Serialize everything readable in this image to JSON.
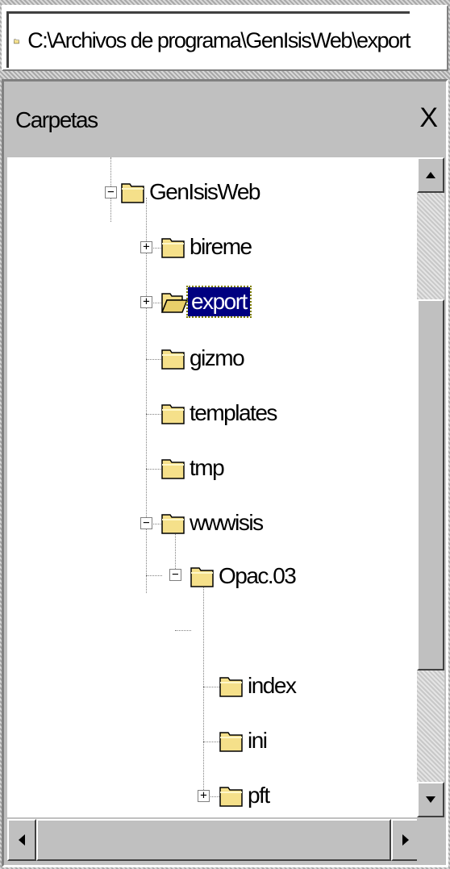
{
  "address": {
    "path": "C:\\Archivos de programa\\GenIsisWeb\\export",
    "icon": "folder-icon"
  },
  "panel": {
    "title": "Carpetas",
    "close_label": "X"
  },
  "tree": {
    "root": "GenIsisWeb",
    "items": [
      {
        "label": "GenIsisWeb",
        "expander": "−"
      },
      {
        "label": "bireme",
        "expander": "+"
      },
      {
        "label": "export",
        "expander": "+",
        "selected": true,
        "open": true
      },
      {
        "label": "gizmo"
      },
      {
        "label": "templates"
      },
      {
        "label": "tmp"
      },
      {
        "label": "wwwisis",
        "expander": "−"
      },
      {
        "label": "Opac.03",
        "expander": "−"
      },
      {
        "label": "index"
      },
      {
        "label": "ini"
      },
      {
        "label": "pft",
        "expander": "+"
      }
    ]
  },
  "scroll": {
    "up": "▲",
    "down": "▼",
    "left": "◀",
    "right": "▶"
  },
  "colors": {
    "selection": "#000080",
    "folder": "#f5e08a",
    "chrome": "#c0c0c0"
  }
}
